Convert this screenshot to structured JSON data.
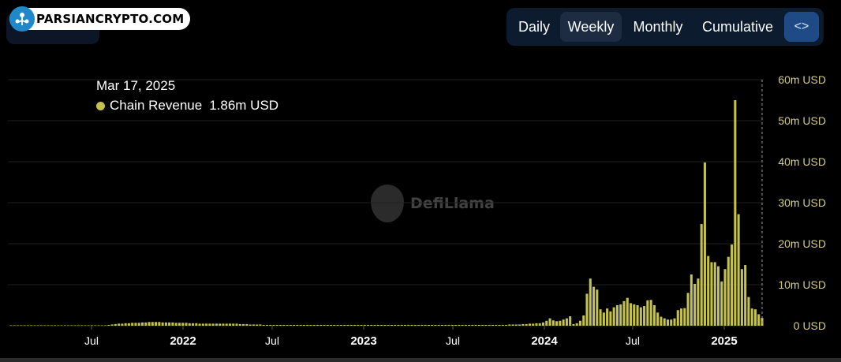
{
  "brand": {
    "logo_text": "PARSIANCRYPTO.COM",
    "icon": "brand-logo-icon"
  },
  "period_tabs": [
    {
      "label": "Daily",
      "active": false
    },
    {
      "label": "Weekly",
      "active": true
    },
    {
      "label": "Monthly",
      "active": false
    },
    {
      "label": "Cumulative",
      "active": false
    }
  ],
  "embed": {
    "glyph": "<>",
    "icon": "code-embed-icon"
  },
  "tooltip": {
    "date": "Mar 17, 2025",
    "series": "Chain Revenue",
    "value": "1.86m USD"
  },
  "watermark": {
    "text": "DefiLlama",
    "icon": "defillama-llama-icon"
  },
  "colors": {
    "background": "#000000",
    "bar": "#c4c14c",
    "grid": "#1f1f1f",
    "axis_text": "#ffffff",
    "y_tick_text": "#d6cf7e",
    "active_tab": "#1d2c40",
    "embed_button": "#1e4b86"
  },
  "chart_data": {
    "type": "bar",
    "series": [
      {
        "name": "Chain Revenue",
        "unit": "m USD",
        "values": [
          0.1,
          0.1,
          0.1,
          0.1,
          0.1,
          0.1,
          0.1,
          0.1,
          0.1,
          0.1,
          0.1,
          0.1,
          0.1,
          0.1,
          0.1,
          0.1,
          0.1,
          0.1,
          0.1,
          0.1,
          0.1,
          0.1,
          0.1,
          0.1,
          0.1,
          0.1,
          0.1,
          0.1,
          0.1,
          0.2,
          0.3,
          0.4,
          0.5,
          0.5,
          0.6,
          0.6,
          0.7,
          0.7,
          0.7,
          0.8,
          0.8,
          0.9,
          0.9,
          0.9,
          0.9,
          0.8,
          0.8,
          0.8,
          0.8,
          0.7,
          0.7,
          0.7,
          0.7,
          0.6,
          0.6,
          0.6,
          0.5,
          0.5,
          0.5,
          0.5,
          0.5,
          0.5,
          0.5,
          0.5,
          0.5,
          0.5,
          0.5,
          0.5,
          0.4,
          0.4,
          0.4,
          0.3,
          0.3,
          0.3,
          0.3,
          0.2,
          0.2,
          0.2,
          0.2,
          0.2,
          0.2,
          0.2,
          0.2,
          0.2,
          0.2,
          0.2,
          0.2,
          0.2,
          0.2,
          0.2,
          0.2,
          0.2,
          0.2,
          0.2,
          0.2,
          0.2,
          0.2,
          0.2,
          0.2,
          0.2,
          0.2,
          0.2,
          0.2,
          0.2,
          0.2,
          0.2,
          0.2,
          0.2,
          0.2,
          0.2,
          0.2,
          0.2,
          0.2,
          0.2,
          0.2,
          0.2,
          0.2,
          0.2,
          0.2,
          0.2,
          0.2,
          0.2,
          0.2,
          0.2,
          0.2,
          0.2,
          0.2,
          0.2,
          0.2,
          0.2,
          0.2,
          0.2,
          0.2,
          0.2,
          0.2,
          0.2,
          0.2,
          0.2,
          0.2,
          0.2,
          0.2,
          0.2,
          0.2,
          0.2,
          0.2,
          0.2,
          0.2,
          0.2,
          0.3,
          0.3,
          0.3,
          0.3,
          0.4,
          0.4,
          0.5,
          0.5,
          0.6,
          0.6,
          0.8,
          1.2,
          1.8,
          1.3,
          1.1,
          1.2,
          1.5,
          1.8,
          2.3,
          0.4,
          0.6,
          1.2,
          2.5,
          7.8,
          11.5,
          9.5,
          8.8,
          4.0,
          3.2,
          4.2,
          3.5,
          4.5,
          5.0,
          5.2,
          6.0,
          6.8,
          5.5,
          5.2,
          5.0,
          4.5,
          4.8,
          6.2,
          6.3,
          5.0,
          3.2,
          2.2,
          1.8,
          1.5,
          1.5,
          1.8,
          3.8,
          4.2,
          4.3,
          8.0,
          12.5,
          10.2,
          11.5,
          24.8,
          39.8,
          17.0,
          15.5,
          15.5,
          14.5,
          10.8,
          13.8,
          16.8,
          19.8,
          55.0,
          27.2,
          13.8,
          14.8,
          7.0,
          4.2,
          4.0,
          2.8,
          1.9
        ]
      }
    ],
    "x_range": [
      "2021-01-04",
      "2025-03-17"
    ],
    "x_ticks": [
      "Jul",
      "2022",
      "Jul",
      "2023",
      "Jul",
      "2024",
      "Jul",
      "2025"
    ],
    "y_ticks": [
      "0 USD",
      "10m USD",
      "20m USD",
      "30m USD",
      "40m USD",
      "50m USD",
      "60m USD"
    ],
    "ylim": [
      0,
      60
    ],
    "grid": true,
    "legend": "none"
  }
}
